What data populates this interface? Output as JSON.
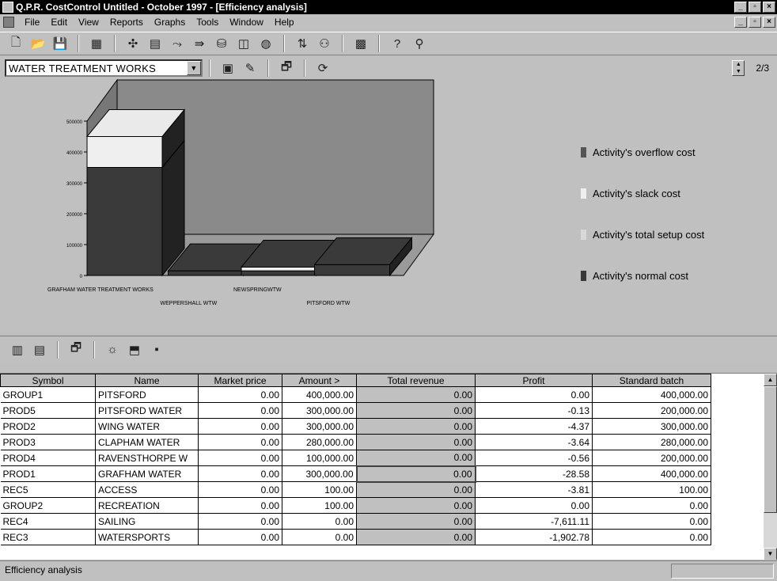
{
  "window": {
    "title": "Q.P.R. CostControl Untitled - October 1997  - [Efficiency analysis]"
  },
  "menu": [
    "File",
    "Edit",
    "View",
    "Reports",
    "Graphs",
    "Tools",
    "Window",
    "Help"
  ],
  "toolbar_icons": [
    "new-icon",
    "open-icon",
    "save-icon",
    "sheet-icon",
    "group-icon",
    "stack-icon",
    "flow-icon",
    "arrow-icon",
    "database-icon",
    "window-icon",
    "globe-icon",
    "sort-icon",
    "people-icon",
    "calculator-icon",
    "help-icon",
    "wand-icon"
  ],
  "selector": {
    "value": "WATER TREATMENT WORKS"
  },
  "pager": {
    "text": "2/3"
  },
  "chart_data": {
    "type": "bar",
    "stacked": true,
    "three_d": true,
    "categories": [
      "GRAFHAM WATER TREATMENT WORKS",
      "WEPPERSHALL WTW",
      "NEWSPRINGWTW",
      "PITSFORD WTW"
    ],
    "y_ticks": [
      "0",
      "100000",
      "200000",
      "300000",
      "400000",
      "500000"
    ],
    "ylim": [
      0,
      500000
    ],
    "series": [
      {
        "name": "Activity's normal cost",
        "color": "#3a3a3a",
        "values": [
          350000,
          15000,
          15000,
          35000
        ]
      },
      {
        "name": "Activity's total setup cost",
        "color": "#d8d8d8",
        "values": [
          0,
          0,
          0,
          0
        ]
      },
      {
        "name": "Activity's slack cost",
        "color": "#efefef",
        "values": [
          100000,
          0,
          12000,
          0
        ]
      },
      {
        "name": "Activity's overflow cost",
        "color": "#555555",
        "values": [
          0,
          0,
          0,
          0
        ]
      }
    ],
    "legend": [
      "Activity's overflow cost",
      "Activity's slack cost",
      "Activity's total setup cost",
      "Activity's normal cost"
    ],
    "legend_colors": [
      "#555555",
      "#efefef",
      "#d8d8d8",
      "#3a3a3a"
    ],
    "legend_position": "right"
  },
  "table": {
    "columns": [
      "Symbol",
      "Name",
      "Market price",
      "Amount >",
      "Total revenue",
      "Profit",
      "Standard batch"
    ],
    "rows": [
      [
        "GROUP1",
        "PITSFORD",
        "0.00",
        "400,000.00",
        "0.00",
        "0.00",
        "400,000.00"
      ],
      [
        "PROD5",
        "PITSFORD WATER",
        "0.00",
        "300,000.00",
        "0.00",
        "-0.13",
        "200,000.00"
      ],
      [
        "PROD2",
        "WING WATER",
        "0.00",
        "300,000.00",
        "0.00",
        "-4.37",
        "300,000.00"
      ],
      [
        "PROD3",
        "CLAPHAM WATER",
        "0.00",
        "280,000.00",
        "0.00",
        "-3.64",
        "280,000.00"
      ],
      [
        "PROD4",
        "RAVENSTHORPE W",
        "0.00",
        "100,000.00",
        "0.00",
        "-0.56",
        "200,000.00"
      ],
      [
        "PROD1",
        "GRAFHAM WATER",
        "0.00",
        "300,000.00",
        "0.00",
        "-28.58",
        "400,000.00"
      ],
      [
        "REC5",
        "ACCESS",
        "0.00",
        "100.00",
        "0.00",
        "-3.81",
        "100.00"
      ],
      [
        "GROUP2",
        "RECREATION",
        "0.00",
        "100.00",
        "0.00",
        "0.00",
        "0.00"
      ],
      [
        "REC4",
        "SAILING",
        "0.00",
        "0.00",
        "0.00",
        "-7,611.11",
        "0.00"
      ],
      [
        "REC3",
        "WATERSPORTS",
        "0.00",
        "0.00",
        "0.00",
        "-1,902.78",
        "0.00"
      ]
    ]
  },
  "status": {
    "text": "Efficiency analysis"
  }
}
